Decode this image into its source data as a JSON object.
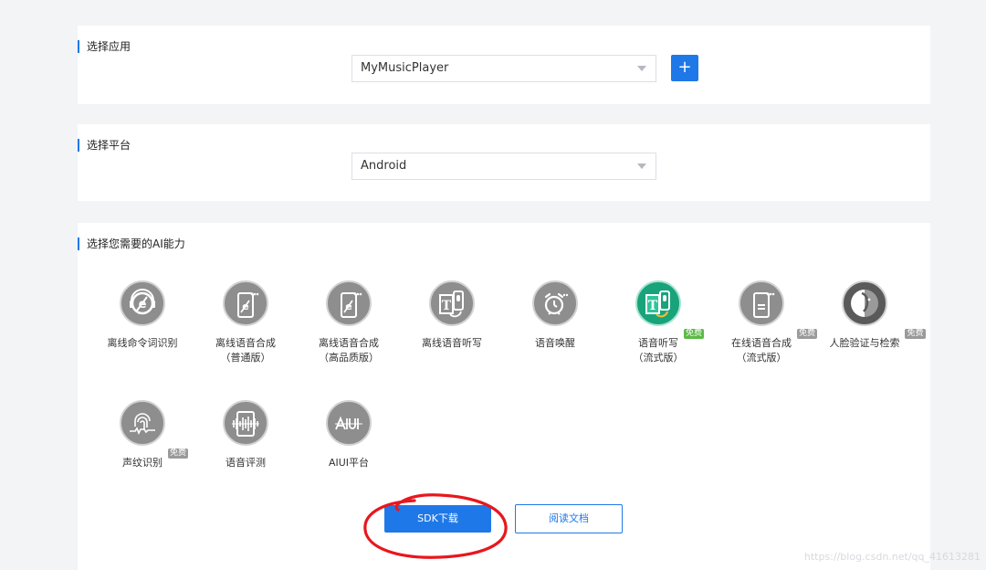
{
  "app_section": {
    "title": "选择应用",
    "selected": "MyMusicPlayer",
    "add_label": "+"
  },
  "platform_section": {
    "title": "选择平台",
    "selected": "Android"
  },
  "ability_section": {
    "title": "选择您需要的AI能力",
    "items": [
      {
        "name": "离线命令词识别",
        "sub": "",
        "badge": "",
        "icon": "offline-command-icon"
      },
      {
        "name": "离线语音合成",
        "sub": "（普通版）",
        "badge": "",
        "icon": "offline-tts-icon"
      },
      {
        "name": "离线语音合成",
        "sub": "（高品质版）",
        "badge": "",
        "icon": "offline-tts-hq-icon"
      },
      {
        "name": "离线语音听写",
        "sub": "",
        "badge": "",
        "icon": "offline-dictation-icon"
      },
      {
        "name": "语音唤醒",
        "sub": "",
        "badge": "",
        "icon": "voice-wakeup-icon"
      },
      {
        "name": "语音听写",
        "sub": "（流式版）",
        "badge": "免费",
        "icon": "dictation-icon"
      },
      {
        "name": "在线语音合成",
        "sub": "（流式版）",
        "badge": "免费",
        "icon": "online-tts-icon"
      },
      {
        "name": "人脸验证与检索",
        "sub": "",
        "badge": "免费",
        "icon": "face-verify-icon"
      },
      {
        "name": "声纹识别",
        "sub": "",
        "badge": "免费",
        "icon": "voiceprint-icon"
      },
      {
        "name": "语音评测",
        "sub": "",
        "badge": "",
        "icon": "speech-eval-icon"
      },
      {
        "name": "AIUI平台",
        "sub": "",
        "badge": "",
        "icon": "aiui-icon"
      }
    ]
  },
  "actions": {
    "sdk_download": "SDK下载",
    "read_docs": "阅读文档"
  },
  "watermark": "https://blog.csdn.net/qq_41613281",
  "colors": {
    "accent": "#1f78e8",
    "icon_gray": "#8e8e8e",
    "icon_green": "#19a37a",
    "annotation_red": "#e8171d"
  }
}
